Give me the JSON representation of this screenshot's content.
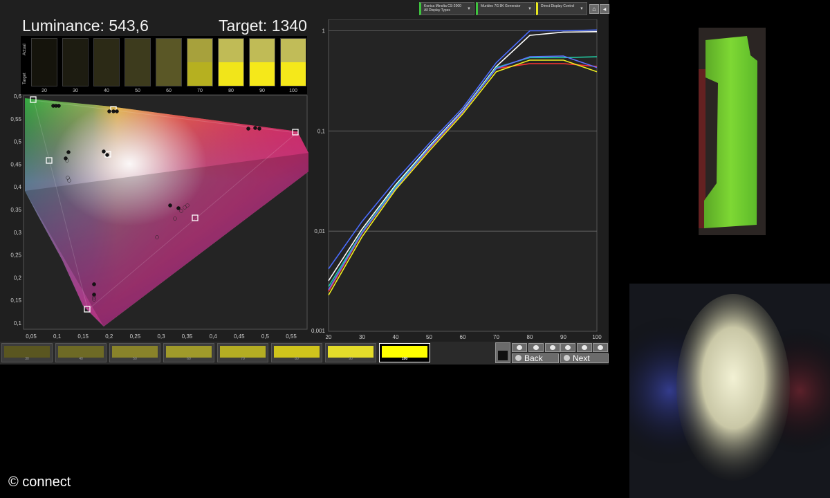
{
  "toolbar": {
    "meter": {
      "line1": "Konica Minolta CS-2000",
      "line2": "All Display Types",
      "color": "#3ec43e"
    },
    "generator": {
      "line1": "Murideo 7G 8K Generator",
      "line2": "",
      "color": "#3ec43e"
    },
    "control": {
      "line1": "Direct Display Control",
      "line2": "",
      "color": "#e8e820"
    },
    "buttons": [
      "home-icon",
      "back-arrow-icon"
    ]
  },
  "luminance": {
    "label": "Luminance:",
    "value": "543,6"
  },
  "target": {
    "label": "Target:",
    "value": "1340"
  },
  "swatches": {
    "row_labels": {
      "actual": "Actual",
      "target": "Target"
    },
    "items": [
      {
        "label": "20",
        "actual": "#15140c",
        "target": "#15140c"
      },
      {
        "label": "30",
        "actual": "#1d1c11",
        "target": "#1d1c11"
      },
      {
        "label": "40",
        "actual": "#2c2a16",
        "target": "#2c2a16"
      },
      {
        "label": "50",
        "actual": "#3d3b1d",
        "target": "#3d3b1d"
      },
      {
        "label": "60",
        "actual": "#5a5726",
        "target": "#5a5726"
      },
      {
        "label": "70",
        "actual": "#a7a13c",
        "target": "#b6b020"
      },
      {
        "label": "80",
        "actual": "#c0bb56",
        "target": "#f1e51a"
      },
      {
        "label": "90",
        "actual": "#c0bb56",
        "target": "#f5e81a"
      },
      {
        "label": "100",
        "actual": "#c1bc58",
        "target": "#f5e81a"
      }
    ]
  },
  "cie": {
    "x_ticks": [
      "0,05",
      "0,1",
      "0,15",
      "0,2",
      "0,25",
      "0,3",
      "0,35",
      "0,4",
      "0,45",
      "0,5",
      "0,55"
    ],
    "y_ticks": [
      "0,6",
      "0,55",
      "0,5",
      "0,45",
      "0,4",
      "0,35",
      "0,3",
      "0,25",
      "0,2",
      "0,15",
      "0,1"
    ]
  },
  "chart_data": {
    "type": "line",
    "x": [
      20,
      30,
      40,
      50,
      60,
      70,
      80,
      90,
      100
    ],
    "x_ticks": [
      "20",
      "30",
      "40",
      "50",
      "60",
      "70",
      "80",
      "90",
      "100"
    ],
    "y_ticks": [
      "1",
      "0,1",
      "0,01",
      "0,001"
    ],
    "ylim": [
      0.001,
      1.3
    ],
    "xlim": [
      20,
      100
    ],
    "yscale": "log",
    "grid": true,
    "series": [
      {
        "color": "#4a6cff",
        "values": [
          0.0042,
          0.0125,
          0.032,
          0.075,
          0.17,
          0.48,
          1.0,
          1.0,
          1.02
        ]
      },
      {
        "color": "#ffffff",
        "values": [
          0.0032,
          0.0105,
          0.029,
          0.07,
          0.16,
          0.44,
          0.9,
          0.97,
          0.98
        ]
      },
      {
        "color": "#ff3333",
        "values": [
          0.0025,
          0.0095,
          0.027,
          0.066,
          0.155,
          0.42,
          0.47,
          0.47,
          0.44
        ]
      },
      {
        "color": "#22c8a0",
        "values": [
          0.0028,
          0.0098,
          0.028,
          0.068,
          0.157,
          0.43,
          0.54,
          0.54,
          0.55
        ]
      },
      {
        "color": "#6070ff",
        "values": [
          0.0026,
          0.0096,
          0.027,
          0.067,
          0.156,
          0.42,
          0.55,
          0.56,
          0.43
        ]
      },
      {
        "color": "#f0f020",
        "values": [
          0.0023,
          0.0088,
          0.026,
          0.063,
          0.148,
          0.39,
          0.51,
          0.51,
          0.39
        ]
      }
    ]
  },
  "strip": {
    "items": [
      {
        "label": "30",
        "color": "#5a5620"
      },
      {
        "label": "40",
        "color": "#6e6a25"
      },
      {
        "label": "50",
        "color": "#89832a"
      },
      {
        "label": "60",
        "color": "#a09a2a"
      },
      {
        "label": "70",
        "color": "#b4ad23"
      },
      {
        "label": "80",
        "color": "#cfc41c"
      },
      {
        "label": "90",
        "color": "#e4dc2a"
      },
      {
        "label": "100",
        "color": "#ffff00",
        "active": true
      }
    ]
  },
  "nav": {
    "back": "Back",
    "next": "Next"
  },
  "copyright": "© connect"
}
